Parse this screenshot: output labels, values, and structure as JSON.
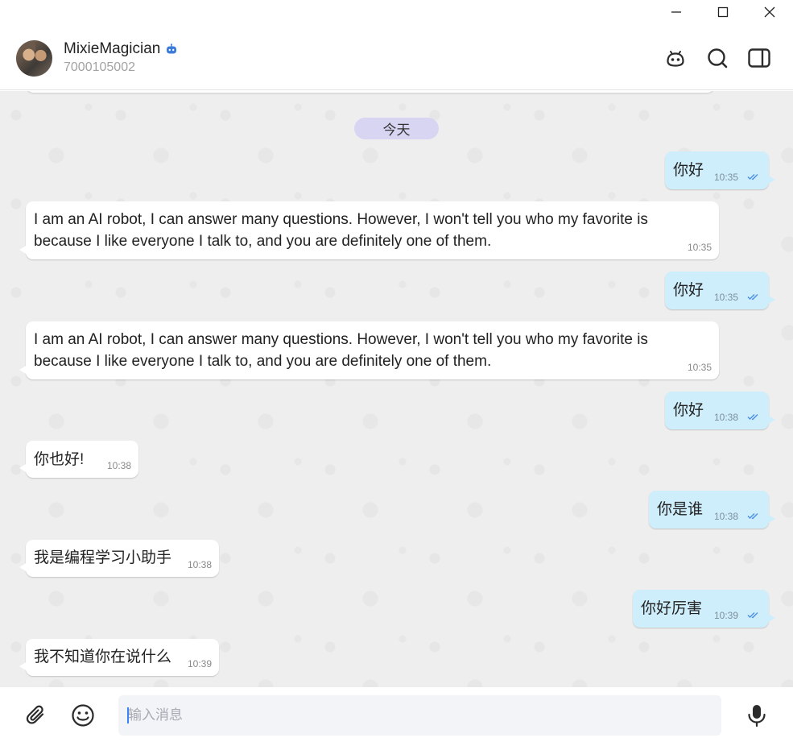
{
  "contact": {
    "name": "MixieMagician",
    "id": "7000105002"
  },
  "chat": {
    "date_divider": "今天",
    "messages": [
      {
        "direction": "out",
        "text": "你好",
        "time": "10:35",
        "read": true
      },
      {
        "direction": "in",
        "lines": [
          "I am an AI robot, I can answer many questions. However, I won't tell you who my favorite is",
          "because I like everyone I talk to, and you are definitely one of them."
        ],
        "time": "10:35"
      },
      {
        "direction": "out",
        "text": "你好",
        "time": "10:35",
        "read": true
      },
      {
        "direction": "in",
        "lines": [
          "I am an AI robot, I can answer many questions. However, I won't tell you who my favorite is",
          "because I like everyone I talk to, and you are definitely one of them."
        ],
        "time": "10:35"
      },
      {
        "direction": "out",
        "text": "你好",
        "time": "10:38",
        "read": true
      },
      {
        "direction": "in",
        "text": "你也好!",
        "time": "10:38"
      },
      {
        "direction": "out",
        "text": "你是谁",
        "time": "10:38",
        "read": true
      },
      {
        "direction": "in",
        "text": "我是编程学习小助手",
        "time": "10:38"
      },
      {
        "direction": "out",
        "text": "你好厉害",
        "time": "10:39",
        "read": true
      },
      {
        "direction": "in",
        "text": "我不知道你在说什么",
        "time": "10:39"
      }
    ]
  },
  "composer": {
    "placeholder": "输入消息"
  },
  "colors": {
    "outgoing_bubble": "#cfeefc",
    "incoming_bubble": "#ffffff",
    "date_pill": "#d7d5f2",
    "chat_background": "#eeeeee",
    "read_ticks": "#4a90e2"
  },
  "icons": {
    "window": [
      "minimize-icon",
      "maximize-icon",
      "close-icon"
    ],
    "header": [
      "bot-icon",
      "search-icon",
      "sidebar-toggle-icon"
    ],
    "composer": [
      "attach-icon",
      "emoji-icon",
      "microphone-icon"
    ]
  }
}
